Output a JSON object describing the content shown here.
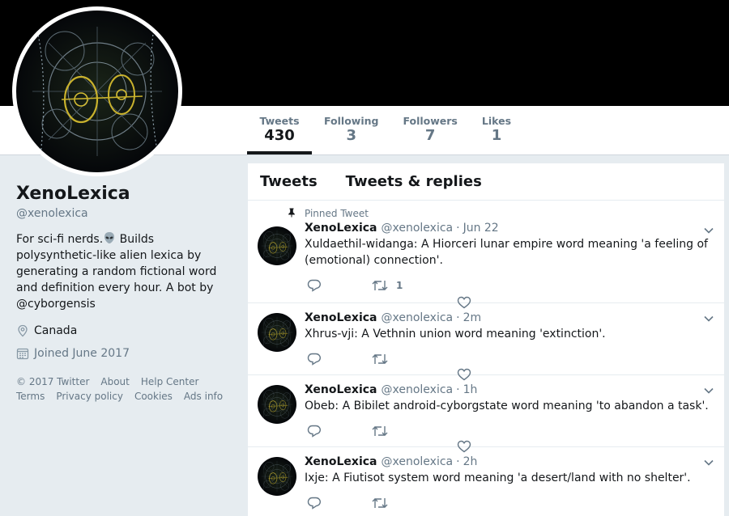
{
  "profile": {
    "name": "XenoLexica",
    "handle": "@xenolexica",
    "bio_before": "For sci-fi nerds.",
    "bio_after": " Builds polysynthetic-like alien lexica by generating a random fictional word and definition every hour. A bot by ",
    "bio_link": "@cyborgensis",
    "location": "Canada",
    "joined": "Joined June 2017"
  },
  "stats": [
    {
      "label": "Tweets",
      "value": "430"
    },
    {
      "label": "Following",
      "value": "3"
    },
    {
      "label": "Followers",
      "value": "7"
    },
    {
      "label": "Likes",
      "value": "1"
    }
  ],
  "footer": {
    "copyright": "© 2017 Twitter",
    "about": "About",
    "help": "Help Center",
    "terms": "Terms",
    "privacy": "Privacy policy",
    "cookies": "Cookies",
    "ads": "Ads info"
  },
  "timeline": {
    "tabs": [
      "Tweets",
      "Tweets & replies"
    ],
    "tweets": [
      {
        "pinned": "Pinned Tweet",
        "name": "XenoLexica",
        "handle": "@xenolexica",
        "time": "Jun 22",
        "text": "Xuldaethil-widanga: A Hiorceri lunar empire word meaning 'a feeling of (emotional) connection'.",
        "retweets": "1"
      },
      {
        "name": "XenoLexica",
        "handle": "@xenolexica",
        "time": "2m",
        "text": "Xhrus-vji: A Vethnin union word meaning 'extinction'."
      },
      {
        "name": "XenoLexica",
        "handle": "@xenolexica",
        "time": "1h",
        "text": "Obeb: A Bibilet android-cyborgstate word meaning 'to abandon a task'."
      },
      {
        "name": "XenoLexica",
        "handle": "@xenolexica",
        "time": "2h",
        "text": "Ixje: A Fiutisot system word meaning 'a desert/land with no shelter'."
      }
    ]
  },
  "icons": {
    "alien": "alien-emoji-icon",
    "location": "location-pin-icon",
    "calendar": "calendar-icon",
    "pin": "pin-icon",
    "reply": "reply-icon",
    "retweet": "retweet-icon",
    "like": "heart-icon",
    "caret": "chevron-down-icon"
  },
  "colors": {
    "banner": "#000000",
    "background": "#e6ecf0",
    "muted": "#657786",
    "text": "#14171a"
  }
}
